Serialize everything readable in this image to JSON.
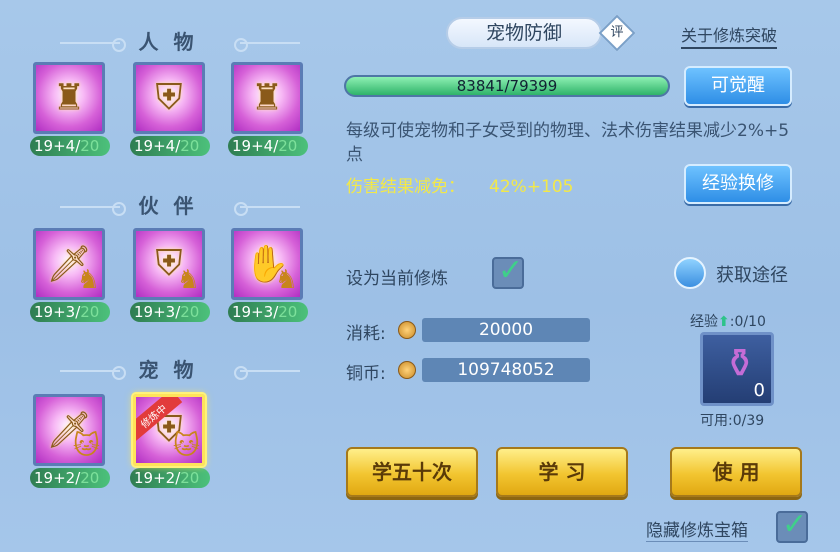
{
  "sections": {
    "characters_title": "人 物",
    "partners_title": "伙 伴",
    "pets_title": "宠 物"
  },
  "slots": {
    "characters": [
      {
        "level": "19+4/",
        "cap": "20"
      },
      {
        "level": "19+4/",
        "cap": "20"
      },
      {
        "level": "19+4/",
        "cap": "20"
      }
    ],
    "partners": [
      {
        "level": "19+3/",
        "cap": "20"
      },
      {
        "level": "19+3/",
        "cap": "20"
      },
      {
        "level": "19+3/",
        "cap": "20"
      }
    ],
    "pets": [
      {
        "level": "19+2/",
        "cap": "20"
      },
      {
        "level": "19+2/",
        "cap": "20",
        "ribbon": "修炼中"
      }
    ]
  },
  "panel": {
    "title": "宠物防御",
    "review_badge": "评",
    "about_link": "关于修炼突破",
    "progress_text": "83841/79399",
    "progress_fraction": 1.0,
    "awaken_button": "可觉醒",
    "description": "每级可使宠物和子女受到的物理、法术伤害结果减少2%+5点",
    "reduction_label": "伤害结果减免：",
    "reduction_value": "42%+105",
    "exchange_button": "经验换修",
    "set_current_label": "设为当前修炼",
    "get_path_label": "获取途径",
    "cost_label": "消耗:",
    "cost_value": "20000",
    "coins_label": "铜币:",
    "coins_value": "109748052",
    "exp_label": "经验",
    "exp_value": ":0/10",
    "item_qty": "0",
    "available_label": "可用:0/39",
    "learn50_button": "学五十次",
    "learn_button": "学 习",
    "use_button": "使 用",
    "hide_box_label": "隐藏修炼宝箱"
  },
  "colors": {
    "accent_gold": "#f2c530",
    "progress_green": "#2fb36a",
    "highlight_yellow": "#f2e84a"
  }
}
